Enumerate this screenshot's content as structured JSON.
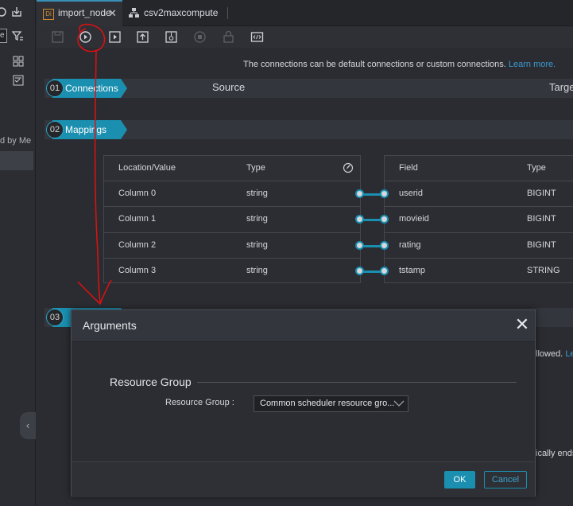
{
  "sidebar": {
    "box_text": "e",
    "fragment_text": "d by Me"
  },
  "tabs": [
    {
      "label": "import_node",
      "badge": "Di"
    },
    {
      "label": "csv2maxcompute"
    }
  ],
  "info": {
    "text": "The connections can be default connections or custom connections.",
    "link": "Learn more."
  },
  "steps": [
    {
      "num": "01",
      "label": "Connections",
      "source": "Source",
      "target": "Targe"
    },
    {
      "num": "02",
      "label": "Mappings"
    },
    {
      "num": "03"
    }
  ],
  "source_table": {
    "headers": [
      "Location/Value",
      "Type"
    ],
    "rows": [
      [
        "Column 0",
        "string"
      ],
      [
        "Column 1",
        "string"
      ],
      [
        "Column 2",
        "string"
      ],
      [
        "Column 3",
        "string"
      ]
    ]
  },
  "target_table": {
    "headers": [
      "Field",
      "Type"
    ],
    "rows": [
      [
        "userid",
        "BIGINT"
      ],
      [
        "movieid",
        "BIGINT"
      ],
      [
        "rating",
        "BIGINT"
      ],
      [
        "tstamp",
        "STRING"
      ]
    ]
  },
  "dialog": {
    "title": "Arguments",
    "section": "Resource Group",
    "label": "Resource Group :",
    "value": "Common scheduler resource gro...",
    "ok": "OK",
    "cancel": "Cancel"
  },
  "behind": {
    "line1": "llowed.",
    "line1_link": "Lea",
    "line2": "ically ends"
  },
  "colors": {
    "accent": "#1a8fb0",
    "link": "#3b9ad1",
    "annotation": "#e01010"
  }
}
